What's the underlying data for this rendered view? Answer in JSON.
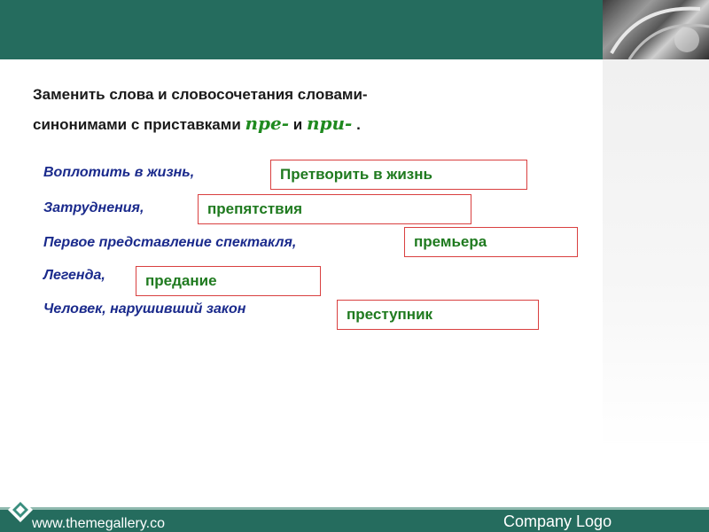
{
  "header": {
    "corner_image_icon": "metallic-swirl-image"
  },
  "instruction": {
    "line1": "Заменить слова и словосочетания словами-",
    "line2_start": "синонимами с приставками ",
    "prefix1": "пре-",
    "between": " и ",
    "prefix2": "при-",
    "end": " ."
  },
  "exercises": [
    {
      "term": "Воплотить в жизнь,",
      "answer": "Претворить в жизнь"
    },
    {
      "term": "Затруднения,",
      "answer": "препятствия"
    },
    {
      "term": "Первое представление спектакля,",
      "answer": "премьера"
    },
    {
      "term": "Легенда,",
      "answer": "предание"
    },
    {
      "term": "Человек, нарушивший закон",
      "answer": "преступник"
    }
  ],
  "footer": {
    "url": "www.themegallery.co",
    "company": "Company Logo",
    "logo_icon": "diamond-logo-icon"
  },
  "colors": {
    "bar": "#256c5e",
    "term_text": "#1a2a8c",
    "answer_text": "#1f7a1f",
    "box_border": "#d94040",
    "prefix_text": "#1f8a1f"
  }
}
